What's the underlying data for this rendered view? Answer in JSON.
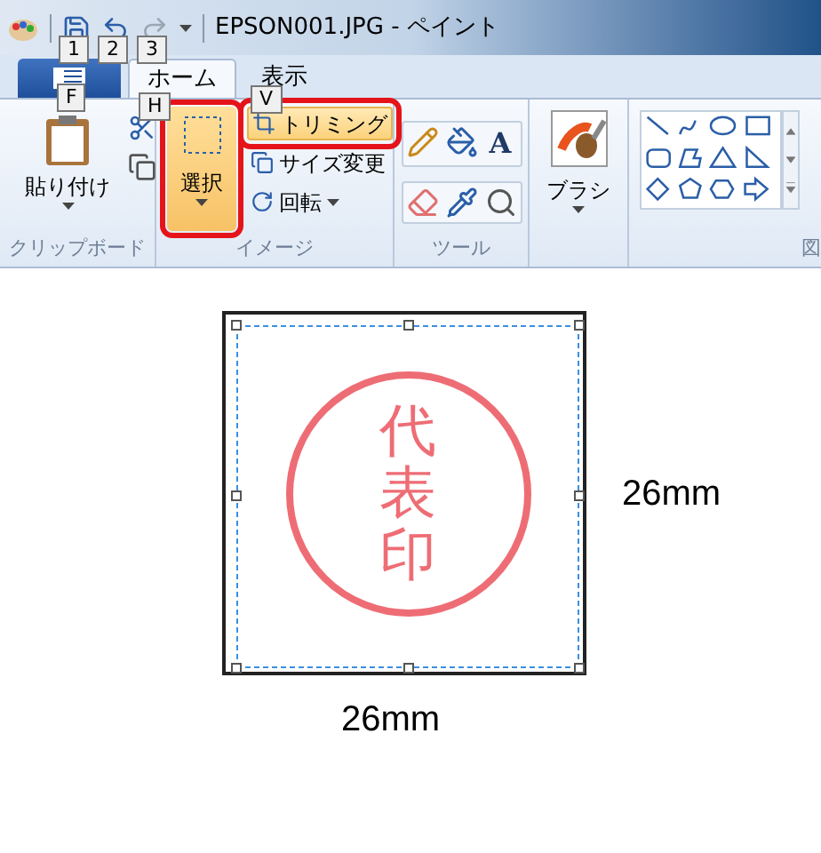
{
  "title_bar": {
    "title": "EPSON001.JPG - ペイント",
    "quick_access": [
      {
        "keytip": "1",
        "disabled": false
      },
      {
        "keytip": "2",
        "disabled": false
      },
      {
        "keytip": "3",
        "disabled": true
      }
    ]
  },
  "file_button": {
    "keytip": "F"
  },
  "tabs": [
    {
      "label": "ホーム",
      "selected": true,
      "keytip": "H"
    },
    {
      "label": "表示",
      "selected": false,
      "keytip": "V"
    }
  ],
  "ribbon": {
    "clipboard": {
      "paste": "貼り付け",
      "label": "クリップボード"
    },
    "image": {
      "select": {
        "label": "選択",
        "highlighted": true,
        "circled": true
      },
      "commands": [
        {
          "label": "トリミング",
          "highlighted": true,
          "circled": true,
          "dropdown": false
        },
        {
          "label": "サイズ変更",
          "highlighted": false,
          "circled": false,
          "dropdown": false
        },
        {
          "label": "回転",
          "highlighted": false,
          "circled": false,
          "dropdown": true
        }
      ],
      "label": "イメージ"
    },
    "tools": {
      "text_tool": "A",
      "label": "ツール"
    },
    "brushes": {
      "label": "ブラシ"
    },
    "shapes": {
      "label": "図"
    }
  },
  "canvas": {
    "stamp_text": "代表印",
    "height_label": "26mm",
    "width_label": "26mm"
  }
}
